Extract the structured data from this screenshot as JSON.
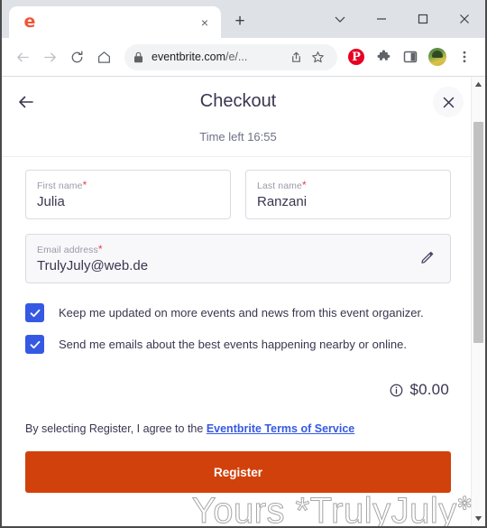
{
  "browser": {
    "tab": {
      "favicon_letter": "e",
      "title": "",
      "close_label": "×"
    },
    "new_tab_label": "+",
    "window_controls": [
      {
        "name": "tab-search",
        "label": "⌄"
      },
      {
        "name": "minimize",
        "label": "—"
      },
      {
        "name": "maximize",
        "label": "□"
      },
      {
        "name": "close",
        "label": "×"
      }
    ],
    "toolbar": {
      "back_icon": "back-arrow-icon",
      "forward_icon": "forward-arrow-icon",
      "reload_icon": "reload-icon",
      "home_icon": "home-icon",
      "lock_icon": "lock-icon",
      "url_domain": "eventbrite.com",
      "url_path": "/e/...",
      "share_icon": "share-icon",
      "bookmark_icon": "star-icon",
      "pinterest_label": "P",
      "extensions_icon": "puzzle-icon",
      "sidepanel_icon": "side-panel-icon",
      "avatar_icon": "avatar",
      "menu_icon": "three-dot-menu-icon"
    }
  },
  "checkout": {
    "back_label": "←",
    "title": "Checkout",
    "close_label": "×",
    "time_left": "Time left 16:55",
    "fields": [
      {
        "name": "first-name",
        "label": "First name",
        "required_marker": "*",
        "value": "Julia",
        "readonly": false
      },
      {
        "name": "last-name",
        "label": "Last name",
        "required_marker": "*",
        "value": "Ranzani",
        "readonly": false
      },
      {
        "name": "email-address",
        "label": "Email address",
        "required_marker": "*",
        "value": "TrulyJuly@web.de",
        "readonly": true,
        "edit_icon": "pencil-icon"
      }
    ],
    "checkboxes": [
      {
        "name": "organizer-updates",
        "label": "Keep me updated on more events and news from this event organizer.",
        "checked": true
      },
      {
        "name": "nearby-events-emails",
        "label": "Send me emails about the best events happening nearby or online.",
        "checked": true
      }
    ],
    "price": {
      "info_icon": "info-icon",
      "amount": "$0.00"
    },
    "terms": {
      "prefix": "By selecting Register, I agree to the ",
      "link_text": "Eventbrite Terms of Service"
    },
    "register_label": "Register"
  },
  "watermark": {
    "text": "Yours *TrulyJuly",
    "star": "✻"
  },
  "colors": {
    "brand_orange": "#d1410c",
    "favicon_orange": "#f05537",
    "checkbox_blue": "#3659e3",
    "link_blue": "#3659e3",
    "text_navy": "#39364f",
    "muted": "#6f7287",
    "required_red": "#e3404c",
    "pinterest_red": "#e60023"
  }
}
